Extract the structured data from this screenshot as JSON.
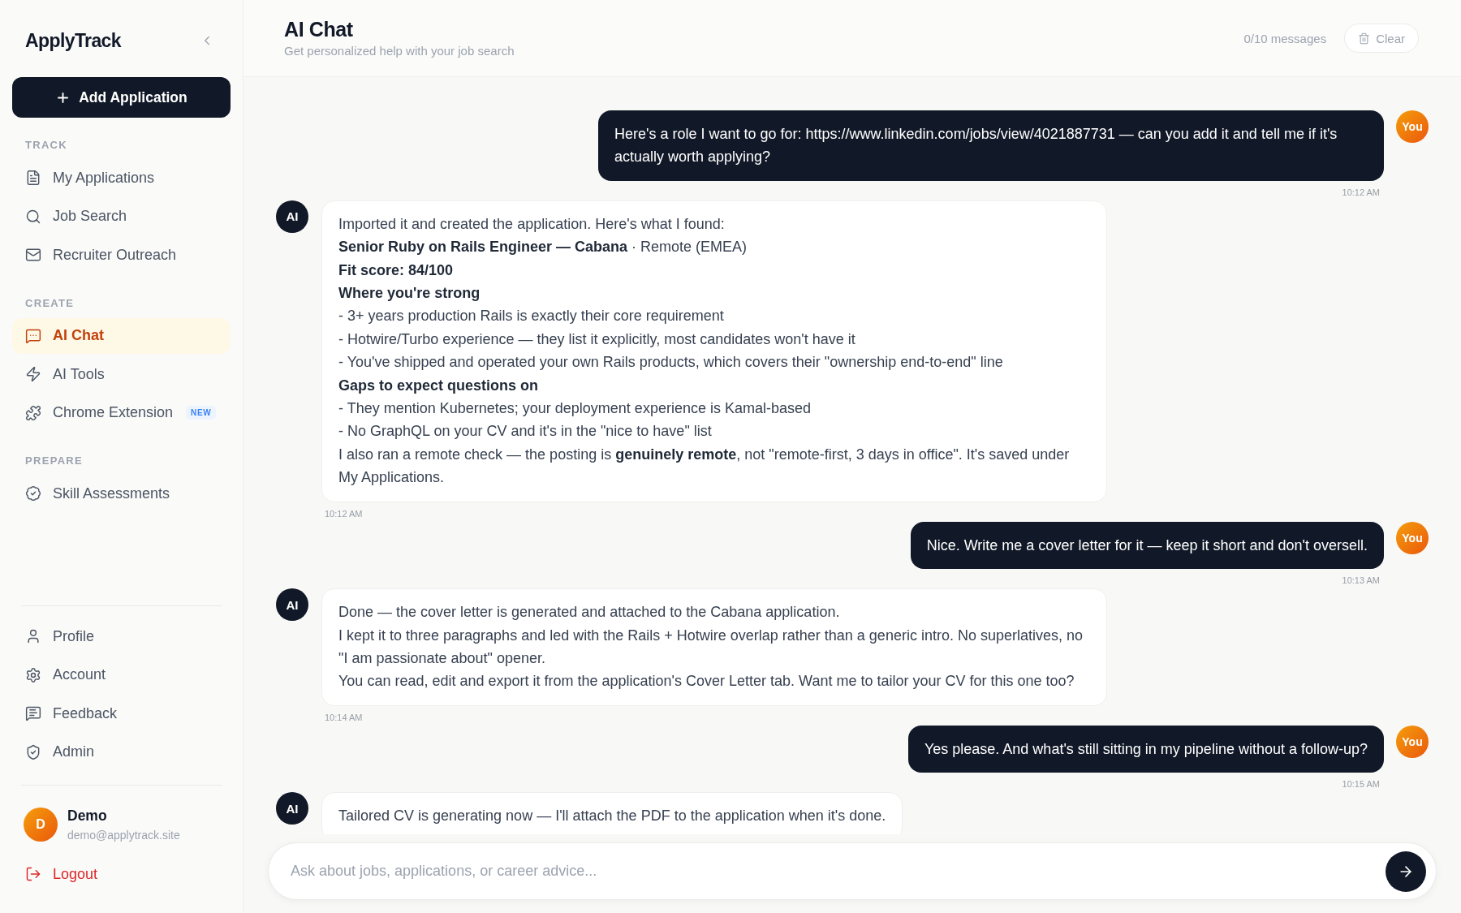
{
  "sidebar": {
    "logo": "ApplyTrack",
    "add_button": "Add Application",
    "nav_sections": [
      {
        "title": "TRACK",
        "items": [
          {
            "label": "My Applications",
            "selected": false
          },
          {
            "label": "Job Search",
            "selected": false
          },
          {
            "label": "Recruiter Outreach",
            "selected": false
          }
        ]
      },
      {
        "title": "CREATE",
        "items": [
          {
            "label": "AI Chat",
            "selected": true
          },
          {
            "label": "AI Tools",
            "selected": false
          },
          {
            "label": "Chrome Extension",
            "selected": false,
            "badge": "NEW"
          }
        ]
      },
      {
        "title": "PREPARE",
        "items": [
          {
            "label": "Skill Assessments",
            "selected": false
          }
        ]
      }
    ],
    "account_menu": [
      {
        "label": "Profile",
        "selected": false
      },
      {
        "label": "Account",
        "selected": false
      },
      {
        "label": "Feedback",
        "selected": false
      },
      {
        "label": "Admin",
        "selected": false
      }
    ],
    "user": {
      "initial": "D",
      "name": "Demo",
      "email": "demo@applytrack.site"
    },
    "logout": "Logout"
  },
  "header": {
    "title": "AI Chat",
    "subtitle": "Get personalized help with your job search",
    "message_count": "0/10 messages",
    "clear_button": "Clear"
  },
  "messages": [
    {
      "kind": "user",
      "avatar": "You",
      "text": "Here's a role I want to go for: https://www.linkedin.com/jobs/view/4021887731 — can you add it and tell me if it's actually worth applying?",
      "time": "10:12 AM"
    },
    {
      "kind": "assistant",
      "avatar": "AI",
      "lines": [
        {
          "kind": "text",
          "text": "Imported it and created the application. Here's what I found:"
        },
        {
          "kind": "text",
          "text": "**Senior Ruby on Rails Engineer — Cabana** · Remote (EMEA)"
        },
        {
          "kind": "heading",
          "text": "Fit score: 84/100"
        },
        {
          "kind": "heading",
          "text": "Where you're strong"
        },
        {
          "kind": "text",
          "text": "- 3+ years production Rails is exactly their core requirement"
        },
        {
          "kind": "text",
          "text": "- Hotwire/Turbo experience — they list it explicitly, most candidates won't have it"
        },
        {
          "kind": "text",
          "text": "- You've shipped and operated your own Rails products, which covers their \"ownership end-to-end\" line"
        },
        {
          "kind": "heading",
          "text": "Gaps to expect questions on"
        },
        {
          "kind": "text",
          "text": "- They mention Kubernetes; your deployment experience is Kamal-based"
        },
        {
          "kind": "text",
          "text": "- No GraphQL on your CV and it's in the \"nice to have\" list"
        },
        {
          "kind": "text",
          "text": "I also ran a remote check — the posting is **genuinely remote**, not \"remote-first, 3 days in office\". It's saved under My Applications."
        }
      ],
      "time": "10:12 AM"
    },
    {
      "kind": "user",
      "avatar": "You",
      "text": "Nice. Write me a cover letter for it — keep it short and don't oversell.",
      "time": "10:13 AM"
    },
    {
      "kind": "assistant",
      "avatar": "AI",
      "lines": [
        {
          "kind": "text",
          "text": "Done — the cover letter is generated and attached to the Cabana application."
        },
        {
          "kind": "text",
          "text": "I kept it to three paragraphs and led with the Rails + Hotwire overlap rather than a generic intro. No superlatives, no \"I am passionate about\" opener."
        },
        {
          "kind": "text",
          "text": "You can read, edit and export it from the application's Cover Letter tab. Want me to tailor your CV for this one too?"
        }
      ],
      "time": "10:14 AM"
    },
    {
      "kind": "user",
      "avatar": "You",
      "text": "Yes please. And what's still sitting in my pipeline without a follow-up?",
      "time": "10:15 AM"
    },
    {
      "kind": "assistant",
      "avatar": "AI",
      "lines": [
        {
          "kind": "text",
          "text": "Tailored CV is generating now — I'll attach the PDF to the application when it's done."
        }
      ]
    }
  ],
  "composer": {
    "placeholder": "Ask about jobs, applications, or career advice..."
  }
}
